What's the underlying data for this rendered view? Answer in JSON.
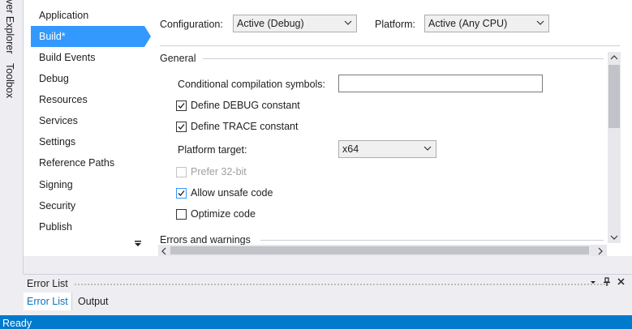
{
  "left_tool_tabs": [
    "ver Explorer",
    "Toolbox"
  ],
  "nav": {
    "items": [
      {
        "label": "Application",
        "active": false
      },
      {
        "label": "Build*",
        "active": true
      },
      {
        "label": "Build Events",
        "active": false
      },
      {
        "label": "Debug",
        "active": false
      },
      {
        "label": "Resources",
        "active": false
      },
      {
        "label": "Services",
        "active": false
      },
      {
        "label": "Settings",
        "active": false
      },
      {
        "label": "Reference Paths",
        "active": false
      },
      {
        "label": "Signing",
        "active": false
      },
      {
        "label": "Security",
        "active": false
      },
      {
        "label": "Publish",
        "active": false
      }
    ]
  },
  "toolbar": {
    "configuration_label": "Configuration:",
    "configuration_value": "Active (Debug)",
    "platform_label": "Platform:",
    "platform_value": "Active (Any CPU)"
  },
  "general": {
    "section_title": "General",
    "symbols_label": "Conditional compilation symbols:",
    "symbols_value": "",
    "define_debug_label": "Define DEBUG constant",
    "define_debug_checked": true,
    "define_trace_label": "Define TRACE constant",
    "define_trace_checked": true,
    "platform_target_label": "Platform target:",
    "platform_target_value": "x64",
    "prefer32_label": "Prefer 32-bit",
    "prefer32_checked": false,
    "prefer32_enabled": false,
    "allow_unsafe_label": "Allow unsafe code",
    "allow_unsafe_checked": true,
    "optimize_label": "Optimize code",
    "optimize_checked": false
  },
  "errors_section_title": "Errors and warnings",
  "error_panel": {
    "title": "Error List",
    "tabs": [
      "Error List",
      "Output"
    ],
    "active_tab": "Error List"
  },
  "status": {
    "text": "Ready"
  },
  "colors": {
    "accent": "#3399ff",
    "statusbar": "#007acc",
    "chrome_bg": "#eeeef2"
  }
}
